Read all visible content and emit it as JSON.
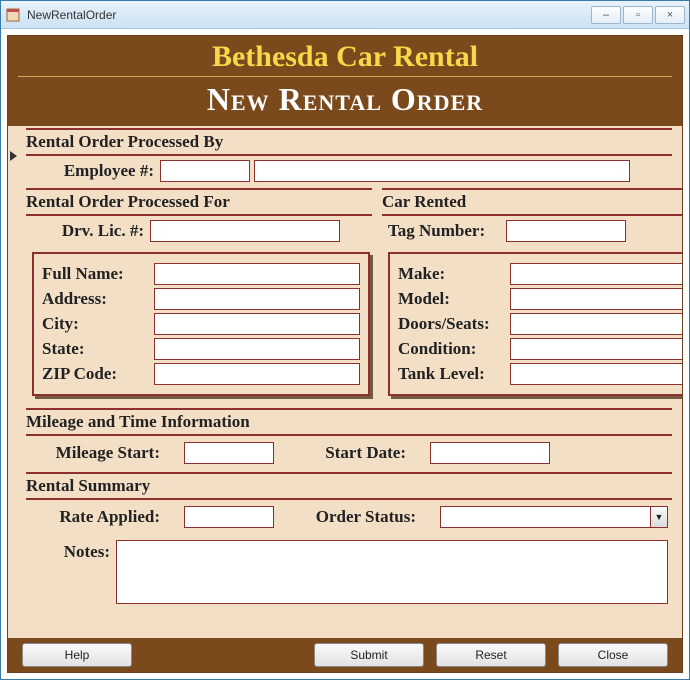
{
  "window": {
    "title": "NewRentalOrder"
  },
  "header": {
    "company": "Bethesda Car Rental",
    "formTitle": "New Rental Order"
  },
  "sections": {
    "processedBy": "Rental Order Processed By",
    "processedFor": "Rental Order Processed For",
    "carRented": "Car Rented",
    "mileage": "Mileage and Time Information",
    "summary": "Rental Summary"
  },
  "labels": {
    "employeeNo": "Employee #:",
    "drvLic": "Drv. Lic. #:",
    "fullName": "Full Name:",
    "address": "Address:",
    "city": "City:",
    "state": "State:",
    "zip": "ZIP Code:",
    "tagNumber": "Tag Number:",
    "make": "Make:",
    "model": "Model:",
    "doorsSeats": "Doors/Seats:",
    "condition": "Condition:",
    "tankLevel": "Tank Level:",
    "mileageStart": "Mileage Start:",
    "startDate": "Start Date:",
    "rateApplied": "Rate Applied:",
    "orderStatus": "Order Status:",
    "notes": "Notes:"
  },
  "values": {
    "employeeNo": "",
    "employeeName": "",
    "drvLic": "",
    "fullName": "",
    "address": "",
    "city": "",
    "state": "",
    "zip": "",
    "tagNumber": "",
    "make": "",
    "model": "",
    "doorsSeats": "",
    "condition": "",
    "tankLevel": "",
    "mileageStart": "",
    "startDate": "",
    "rateApplied": "",
    "orderStatus": "",
    "notes": ""
  },
  "buttons": {
    "help": "Help",
    "submit": "Submit",
    "reset": "Reset",
    "close": "Close"
  }
}
